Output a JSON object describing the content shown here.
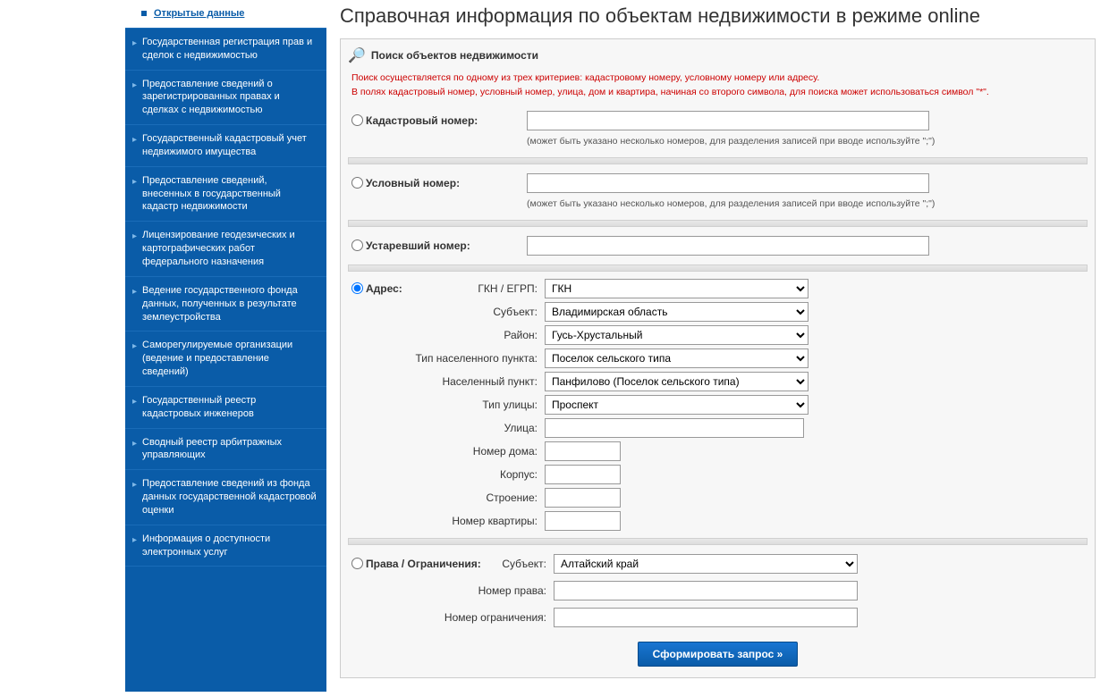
{
  "sidebar": {
    "items": [
      {
        "label": "Открытые данные",
        "active": true
      },
      {
        "label": "Государственная регистрация прав и сделок с недвижимостью"
      },
      {
        "label": "Предоставление сведений о зарегистрированных правах и сделках с недвижимостью"
      },
      {
        "label": "Государственный кадастровый учет недвижимого имущества"
      },
      {
        "label": "Предоставление сведений, внесенных в государственный кадастр недвижимости"
      },
      {
        "label": "Лицензирование геодезических и картографических работ федерального назначения"
      },
      {
        "label": "Ведение государственного фонда данных, полученных в результате землеустройства"
      },
      {
        "label": "Саморегулируемые организации (ведение и предоставление сведений)"
      },
      {
        "label": "Государственный реестр кадастровых инженеров"
      },
      {
        "label": "Сводный реестр арбитражных управляющих"
      },
      {
        "label": "Предоставление сведений из фонда данных государственной кадастровой оценки"
      },
      {
        "label": "Информация о доступности электронных услуг"
      }
    ]
  },
  "page": {
    "title": "Справочная информация по объектам недвижимости в режиме online",
    "panel_title": "Поиск объектов недвижимости",
    "info_line1": "Поиск осуществляется по одному из трех критериев: кадастровому номеру, условному номеру или адресу.",
    "info_line2": "В полях кадастровый номер, условный номер, улица, дом и квартира, начиная со второго символа, для поиска может использоваться символ \"*\"."
  },
  "form": {
    "cadastral": {
      "label": "Кадастровый номер:",
      "hint": "(может быть указано несколько номеров, для разделения записей при вводе используйте \";\")"
    },
    "conditional": {
      "label": "Условный номер:",
      "hint": "(может быть указано несколько номеров, для разделения записей при вводе используйте \";\")"
    },
    "obsolete": {
      "label": "Устаревший номер:"
    },
    "address": {
      "label": "Адрес:",
      "fields": {
        "gkn_label": "ГКН / ЕГРП:",
        "gkn_value": "ГКН",
        "subject_label": "Субъект:",
        "subject_value": "Владимирская область",
        "district_label": "Район:",
        "district_value": "Гусь-Хрустальный",
        "settlement_type_label": "Тип населенного пункта:",
        "settlement_type_value": "Поселок сельского типа",
        "settlement_label": "Населенный пункт:",
        "settlement_value": "Панфилово (Поселок сельского типа)",
        "street_type_label": "Тип улицы:",
        "street_type_value": "Проспект",
        "street_label": "Улица:",
        "house_label": "Номер дома:",
        "building_label": "Корпус:",
        "structure_label": "Строение:",
        "apartment_label": "Номер квартиры:"
      }
    },
    "rights": {
      "label": "Права / Ограничения:",
      "subject_label": "Субъект:",
      "subject_value": "Алтайский край",
      "right_no_label": "Номер права:",
      "restriction_no_label": "Номер ограничения:"
    },
    "submit_label": "Сформировать запрос »"
  }
}
